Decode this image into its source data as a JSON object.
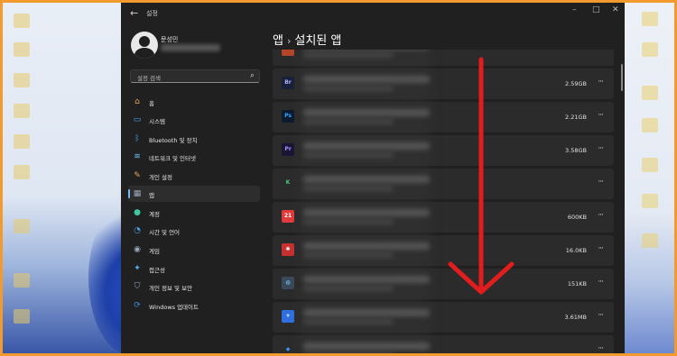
{
  "window": {
    "title": "설정",
    "back_icon": "back-arrow-icon",
    "controls": {
      "minimize": "–",
      "maximize": "□",
      "close": "✕"
    }
  },
  "user": {
    "name": "문성민"
  },
  "search": {
    "placeholder": "설정 검색",
    "icon": "search-icon"
  },
  "sidebar": {
    "items": [
      {
        "label": "홈",
        "icon": "home-icon",
        "color": "#f2a65a",
        "glyph": "⌂"
      },
      {
        "label": "시스템",
        "icon": "monitor-icon",
        "color": "#4aa3e8",
        "glyph": "▭"
      },
      {
        "label": "Bluetooth 및 장치",
        "icon": "bluetooth-icon",
        "color": "#4aa3e8",
        "glyph": "ᛒ"
      },
      {
        "label": "네트워크 및 인터넷",
        "icon": "wifi-icon",
        "color": "#6fc1f2",
        "glyph": "≋"
      },
      {
        "label": "개인 설정",
        "icon": "brush-icon",
        "color": "#e6a35a",
        "glyph": "✎"
      },
      {
        "label": "앱",
        "icon": "apps-icon",
        "color": "#9aa7b8",
        "glyph": "▦",
        "selected": true
      },
      {
        "label": "계정",
        "icon": "account-icon",
        "color": "#3fc8a0",
        "glyph": "●"
      },
      {
        "label": "시간 및 언어",
        "icon": "globe-clock-icon",
        "color": "#4aa3e8",
        "glyph": "◔"
      },
      {
        "label": "게임",
        "icon": "gamepad-icon",
        "color": "#9aa7b8",
        "glyph": "◉"
      },
      {
        "label": "접근성",
        "icon": "accessibility-icon",
        "color": "#5ab4f0",
        "glyph": "✦"
      },
      {
        "label": "개인 정보 및 보안",
        "icon": "shield-icon",
        "color": "#9aa7b8",
        "glyph": "⛉"
      },
      {
        "label": "Windows 업데이트",
        "icon": "update-icon",
        "color": "#3c8fe0",
        "glyph": "⟳"
      }
    ]
  },
  "breadcrumb": {
    "parent": "앱",
    "separator": "›",
    "current": "설치된 앱"
  },
  "apps": [
    {
      "icon": "orange-app-icon",
      "bg": "#b5452a",
      "fg": "#ffffff",
      "glyph": "",
      "size": ""
    },
    {
      "icon": "bridge-app-icon",
      "bg": "#1c1f3a",
      "fg": "#a8b4ff",
      "glyph": "Br",
      "size": "2.59GB"
    },
    {
      "icon": "photoshop-app-icon",
      "bg": "#0d1b2e",
      "fg": "#31a8ff",
      "glyph": "Ps",
      "size": "2.21GB"
    },
    {
      "icon": "premiere-app-icon",
      "bg": "#1c1433",
      "fg": "#9a9aff",
      "glyph": "Pr",
      "size": "3.58GB"
    },
    {
      "icon": "green-k-app-icon",
      "bg": "#2b2b2b",
      "fg": "#3fd17a",
      "glyph": "K",
      "size": ""
    },
    {
      "icon": "red-app-icon",
      "bg": "#e23b3b",
      "fg": "#ffffff",
      "glyph": "21",
      "size": "600KB"
    },
    {
      "icon": "red-square-app-icon",
      "bg": "#c8312f",
      "fg": "#ffffff",
      "glyph": "✱",
      "size": "16.0KB"
    },
    {
      "icon": "disk-app-icon",
      "bg": "#3a4a5a",
      "fg": "#7fd3ff",
      "glyph": "◍",
      "size": "151KB"
    },
    {
      "icon": "blue-plus-app-icon",
      "bg": "#2f6fe0",
      "fg": "#ffffff",
      "glyph": "+",
      "size": "3.61MB"
    },
    {
      "icon": "blue-round-app-icon",
      "bg": "#2b2b2b",
      "fg": "#3f8fff",
      "glyph": "◆",
      "size": ""
    }
  ],
  "more_label": "···",
  "overlay": {
    "arrow_color": "#e21d1d",
    "direction": "down"
  }
}
